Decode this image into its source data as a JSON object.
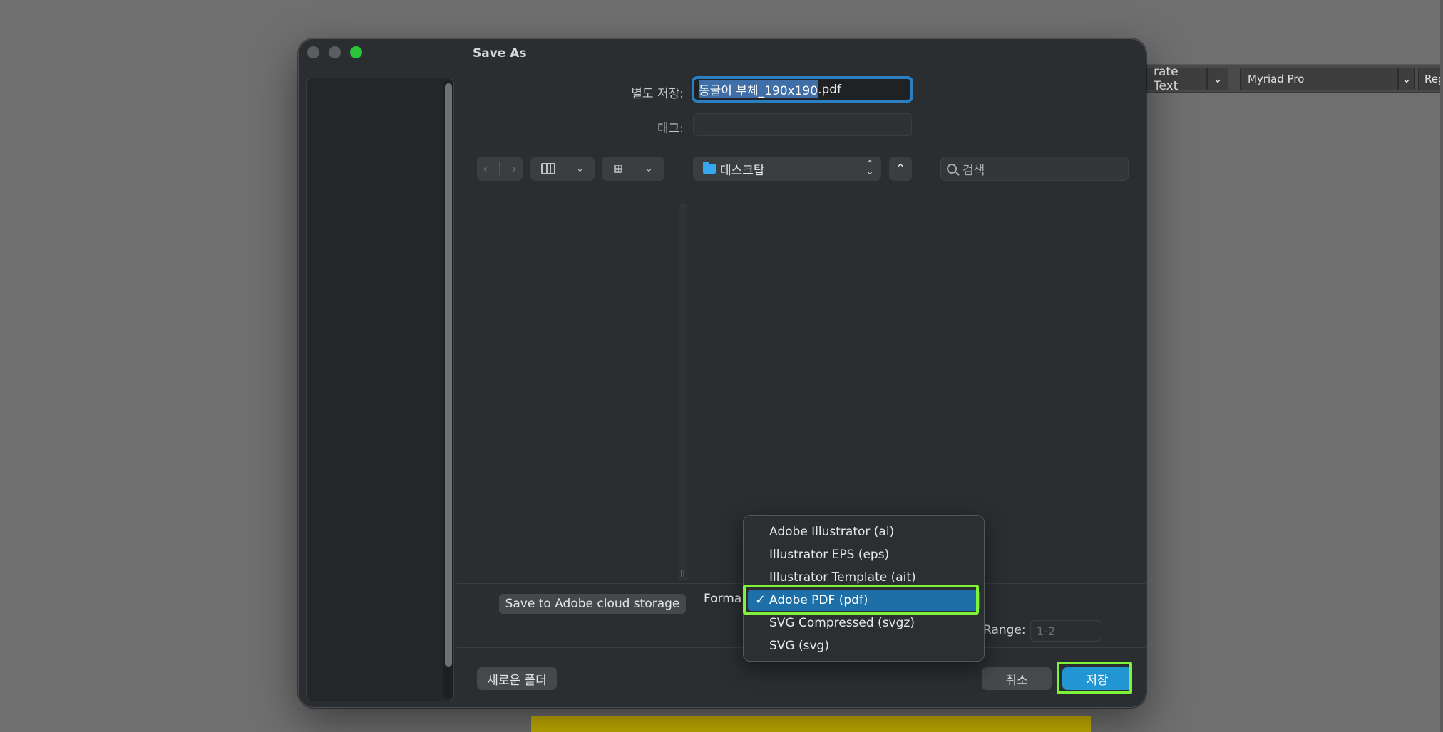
{
  "background_app": {
    "toolbar_text_fragment": "rate Text",
    "font_name": "Myriad Pro",
    "style_fragment": "Reg"
  },
  "dialog": {
    "title": "Save As",
    "filename_label": "별도 저장:",
    "filename_selected_part": "동글이 부체_190x190",
    "filename_extension": ".pdf",
    "tags_label": "태그:",
    "location": "데스크탑",
    "search_placeholder": "검색",
    "cloud_button": "Save to Adobe cloud storage",
    "format_label_fragment": "Forma",
    "range_label_fragment": "Range:",
    "range_value": "1-2",
    "new_folder_button": "새로운 폴더",
    "cancel_button": "취소",
    "save_button": "저장"
  },
  "format_menu": {
    "items": [
      {
        "label": "Adobe Illustrator (ai)",
        "selected": false
      },
      {
        "label": "Illustrator EPS (eps)",
        "selected": false
      },
      {
        "label": "Illustrator Template (ait)",
        "selected": false
      },
      {
        "label": "Adobe PDF (pdf)",
        "selected": true
      },
      {
        "label": "SVG Compressed (svgz)",
        "selected": false
      },
      {
        "label": "SVG (svg)",
        "selected": false
      }
    ],
    "check_mark": "✓"
  },
  "colors": {
    "accent_blue": "#2296d2",
    "highlight_green": "#7ef33a",
    "dialog_bg": "#2b2e31"
  }
}
